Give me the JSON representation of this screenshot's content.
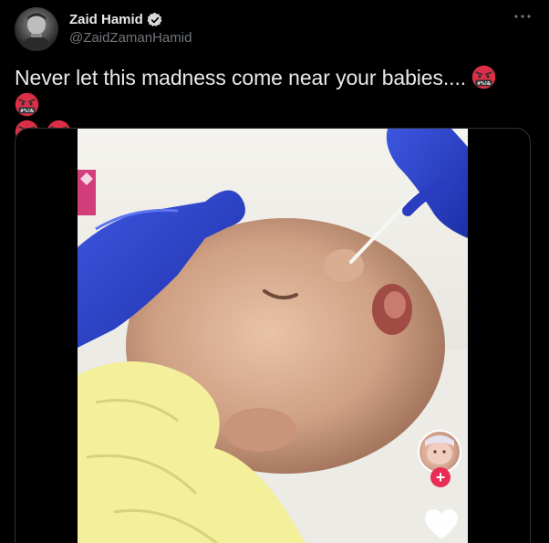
{
  "author": {
    "display_name": "Zaid Hamid",
    "handle": "@ZaidZamanHamid",
    "verified": true
  },
  "tweet": {
    "text_line1": "Never let this madness come near your babies....",
    "emoji_symbol_text": "#%!&",
    "emoji_icon": "angry-face-with-symbols-icon",
    "emoji_icon_2": "angry-face-icon"
  },
  "media": {
    "type": "video",
    "overlay_icons": [
      "creator-avatar-icon",
      "follow-plus-icon",
      "like-heart-icon"
    ],
    "follow_label": "+"
  },
  "colors": {
    "background": "#000000",
    "text_primary": "#e7e9ea",
    "text_secondary": "#71767b",
    "verified_badge": "#d9d9d9",
    "border": "#2f3336",
    "tiktok_plus": "#ea2d57"
  }
}
